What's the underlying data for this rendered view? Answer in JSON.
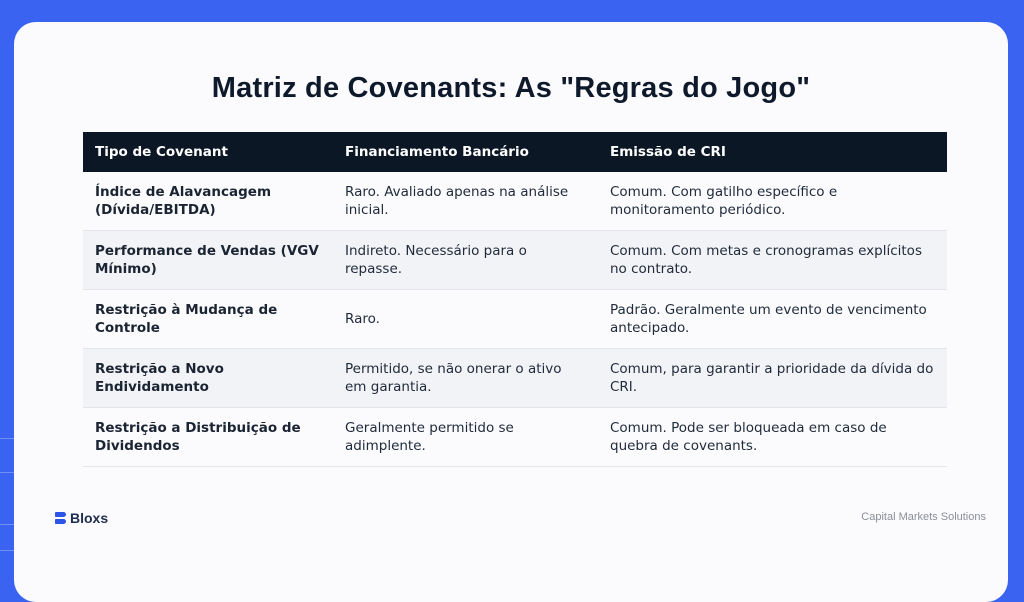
{
  "slide": {
    "title": "Matriz de Covenants: As \"Regras do Jogo\""
  },
  "table": {
    "headers": [
      "Tipo de Covenant",
      "Financiamento Bancário",
      "Emissão de CRI"
    ],
    "rows": [
      [
        "Índice de Alavancagem (Dívida/EBITDA)",
        "Raro. Avaliado apenas na análise inicial.",
        "Comum. Com gatilho específico e monitoramento periódico."
      ],
      [
        "Performance de Vendas (VGV Mínimo)",
        "Indireto. Necessário para o repasse.",
        "Comum. Com metas e cronogramas explícitos no contrato."
      ],
      [
        "Restrição à Mudança de Controle",
        "Raro.",
        "Padrão. Geralmente um evento de vencimento antecipado."
      ],
      [
        "Restrição a Novo Endividamento",
        "Permitido, se não onerar o ativo em garantia.",
        "Comum, para garantir a prioridade da dívida do CRI."
      ],
      [
        "Restrição a Distribuição de Dividendos",
        "Geralmente permitido se adimplente.",
        "Comum. Pode ser bloqueada em caso de quebra de covenants."
      ]
    ]
  },
  "footer": {
    "logo_text": "Bloxs",
    "logo_icon": "bloxs-logo-icon",
    "right_text": "Capital Markets Solutions"
  },
  "colors": {
    "background": "#3b63f2",
    "header_bg": "#0c1726",
    "logo": "#2c55e8"
  }
}
